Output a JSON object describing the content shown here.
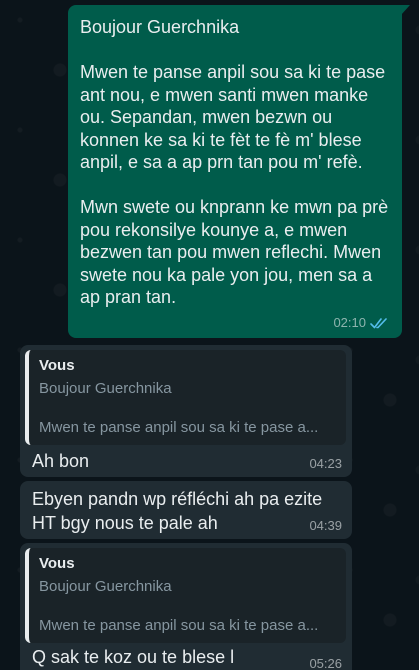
{
  "messages": {
    "outgoing": {
      "text": "Boujour Guerchnika\n\nMwen te panse anpil sou sa ki te pase ant nou, e mwen santi mwen manke ou. Sepandan, mwen bezwn ou konnen ke sa ki te fèt te fè m' blese anpil, e sa a ap prn tan pou m' refè.\n\nMwn swete ou knprann ke mwn pa prè pou rekonsilye kounye a, e mwen bezwen tan pou mwen reflechi. Mwen swete nou ka pale yon jou, men sa a ap pran tan.",
      "time": "02:10",
      "status_icon": "double-check-read"
    },
    "reply1": {
      "quote_author": "Vous",
      "quote_line1": "Boujour Guerchnika",
      "quote_line2": "Mwen te panse anpil sou sa ki te pase a...",
      "text": "Ah bon",
      "time": "04:23"
    },
    "msg2": {
      "text": "Ebyen pandn wp réfléchi ah pa ezite\nHT bgy nous te pale ah",
      "time": "04:39"
    },
    "reply2": {
      "quote_author": "Vous",
      "quote_line1": "Boujour Guerchnika",
      "quote_line2": "Mwen te panse anpil sou sa ki te pase a...",
      "text": "Q sak te koz ou te blese l",
      "time": "05:26"
    }
  },
  "colors": {
    "background": "#0b141a",
    "outgoing_bubble": "#005c4b",
    "incoming_bubble": "#202c33",
    "read_ticks": "#53bdeb"
  }
}
